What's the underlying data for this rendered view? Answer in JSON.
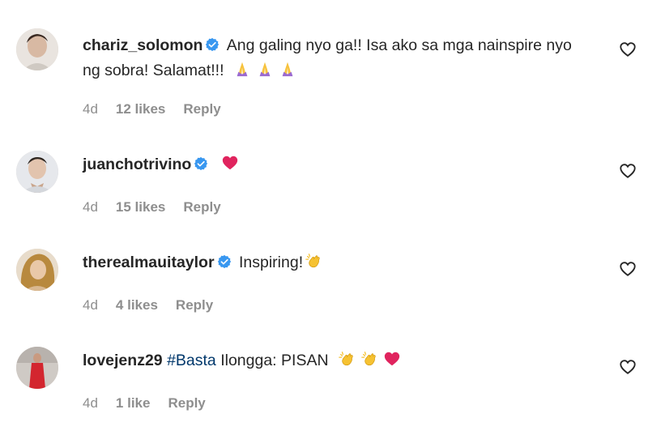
{
  "comments": [
    {
      "username": "chariz_solomon",
      "verified": true,
      "hashtag": "",
      "text": "Ang galing nyo ga!! Isa ako sa mga nainspire nyo ng sobra! Salamat!!!",
      "emojis": [
        "pray-icon",
        "pray-icon",
        "pray-icon"
      ],
      "time": "4d",
      "likes": "12 likes",
      "reply": "Reply"
    },
    {
      "username": "juanchotrivino",
      "verified": true,
      "hashtag": "",
      "text": "",
      "emojis": [
        "red-heart-icon"
      ],
      "time": "4d",
      "likes": "15 likes",
      "reply": "Reply"
    },
    {
      "username": "therealmauitaylor",
      "verified": true,
      "hashtag": "",
      "text": "Inspiring!",
      "emojis": [
        "clap-icon"
      ],
      "time": "4d",
      "likes": "4 likes",
      "reply": "Reply"
    },
    {
      "username": "lovejenz29",
      "verified": false,
      "hashtag": "#Basta",
      "text": "Ilongga: PISAN",
      "emojis": [
        "clap-icon",
        "clap-icon",
        "red-heart-icon"
      ],
      "time": "4d",
      "likes": "1 like",
      "reply": "Reply"
    }
  ],
  "colors": {
    "text": "#262626",
    "muted": "#8e8e8e",
    "verified_blue": "#3897f0",
    "hashtag": "#00376b",
    "heart_red": "#ed4956"
  }
}
